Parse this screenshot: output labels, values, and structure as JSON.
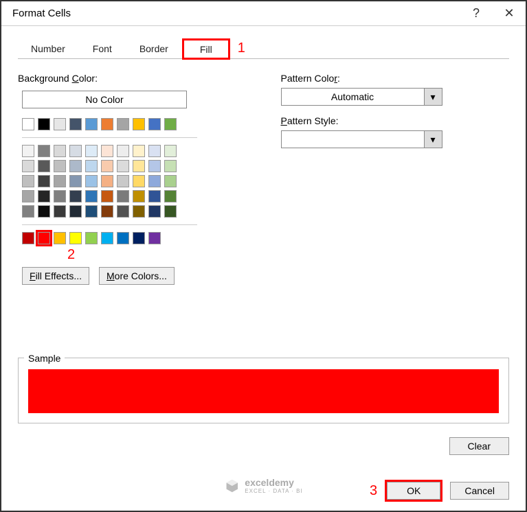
{
  "window": {
    "title": "Format Cells",
    "help_glyph": "?",
    "close_glyph": "✕"
  },
  "tabs": {
    "number": "Number",
    "font": "Font",
    "border": "Border",
    "fill": "Fill"
  },
  "annotations": {
    "one": "1",
    "two": "2",
    "three": "3"
  },
  "fill": {
    "bg_label_pre": "Background ",
    "bg_label_u": "C",
    "bg_label_post": "olor:",
    "no_color": "No Color",
    "fill_effects_u": "F",
    "fill_effects_post": "ill Effects...",
    "more_colors_u": "M",
    "more_colors_post": "ore Colors...",
    "pattern_color_pre": "Pattern Colo",
    "pattern_color_u": "r",
    "pattern_color_post": ":",
    "pattern_color_value": "Automatic",
    "pattern_style_u": "P",
    "pattern_style_post": "attern Style:",
    "row1": [
      "#ffffff",
      "#000000",
      "#e6e6e6",
      "#44546a",
      "#5b9bd5",
      "#ed7d31",
      "#a5a5a5",
      "#ffc000",
      "#4472c4",
      "#70ad47"
    ],
    "extA1": [
      "#f2f2f2",
      "#808080",
      "#d9d9d9",
      "#d6dce4",
      "#ddebf7",
      "#fce4d6",
      "#ededed",
      "#fff2cc",
      "#d9e1f2",
      "#e2efda"
    ],
    "extA2": [
      "#d9d9d9",
      "#595959",
      "#bfbfbf",
      "#acb9ca",
      "#bdd7ee",
      "#f8cbad",
      "#dbdbdb",
      "#ffe699",
      "#b4c6e7",
      "#c6e0b4"
    ],
    "extA3": [
      "#bfbfbf",
      "#404040",
      "#a6a6a6",
      "#8497b0",
      "#9bc2e6",
      "#f4b084",
      "#c9c9c9",
      "#ffd966",
      "#8ea9db",
      "#a9d08e"
    ],
    "extA4": [
      "#a6a6a6",
      "#262626",
      "#808080",
      "#333f4f",
      "#2e75b6",
      "#c65911",
      "#7b7b7b",
      "#bf8f00",
      "#305496",
      "#548235"
    ],
    "extA5": [
      "#808080",
      "#0d0d0d",
      "#3a3a3a",
      "#222b35",
      "#1f4e78",
      "#833c0c",
      "#525252",
      "#806000",
      "#203764",
      "#375623"
    ],
    "std": [
      "#c00000",
      "#ff0000",
      "#ffc000",
      "#ffff00",
      "#92d050",
      "#00b0f0",
      "#0070c0",
      "#002060",
      "#7030a0"
    ]
  },
  "sample_label": "Sample",
  "sample_color": "#ff0000",
  "buttons": {
    "clear": "Clear",
    "ok": "OK",
    "cancel": "Cancel"
  },
  "watermark": {
    "name": "exceldemy",
    "sub": "EXCEL · DATA · BI"
  }
}
